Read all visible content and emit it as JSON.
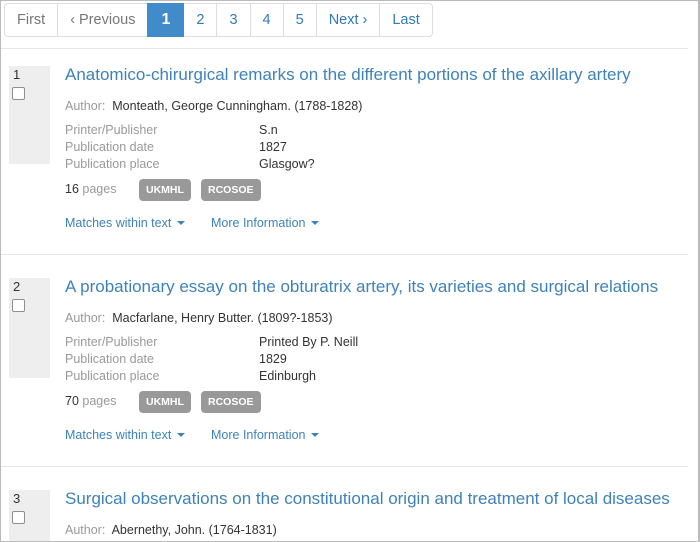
{
  "pagination": {
    "first": "First",
    "previous": "‹ Previous",
    "pages": [
      "1",
      "2",
      "3",
      "4",
      "5"
    ],
    "active": "1",
    "next": "Next ›",
    "last": "Last"
  },
  "labels": {
    "author": "Author:",
    "printer": "Printer/Publisher",
    "pub_date": "Publication date",
    "pub_place": "Publication place",
    "pages_word": "pages",
    "matches": "Matches within text",
    "more_info": "More Information"
  },
  "results": [
    {
      "number": "1",
      "title": "Anatomico-chirurgical remarks on the different portions of the axillary artery",
      "author": "Monteath, George Cunningham. (1788-1828)",
      "printer": "S.n",
      "pub_date": "1827",
      "pub_place": "Glasgow?",
      "pages": "16",
      "badges": [
        "UKMHL",
        "RCOSOE"
      ]
    },
    {
      "number": "2",
      "title": "A probationary essay on the obturatrix artery, its varieties and surgical relations",
      "author": "Macfarlane, Henry Butter. (1809?-1853)",
      "printer": "Printed By P. Neill",
      "pub_date": "1829",
      "pub_place": "Edinburgh",
      "pages": "70",
      "badges": [
        "UKMHL",
        "RCOSOE"
      ]
    },
    {
      "number": "3",
      "title": "Surgical observations on the constitutional origin and treatment of local diseases",
      "author": "Abernethy, John. (1764-1831)"
    }
  ],
  "colors": {
    "link": "#3e82b8",
    "active_page": "#428bca",
    "badge": "#999999",
    "muted": "#999999"
  }
}
